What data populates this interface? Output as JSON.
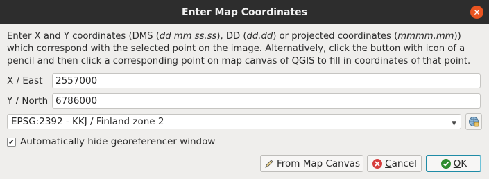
{
  "window": {
    "title": "Enter Map Coordinates",
    "close_icon": "close-icon"
  },
  "description": {
    "p1": "Enter X and Y coordinates (DMS (",
    "p1_em": "dd mm ss.ss",
    "p2": "), DD (",
    "p2_em": "dd.dd",
    "p3": ") or projected coordinates (",
    "p3_em": "mmmm.mm",
    "p4": "))",
    "line2": "which correspond with the selected point on the image. Alternatively, click the button with icon of a",
    "line3": "pencil and then click a corresponding point on map canvas of QGIS to fill in coordinates of that point."
  },
  "x_field": {
    "label": "X / East",
    "value": "2557000"
  },
  "y_field": {
    "label": "Y / North",
    "value": "6786000"
  },
  "crs": {
    "selected": "EPSG:2392 - KKJ / Finland zone 2",
    "button_icon": "crs-selector-icon"
  },
  "auto_hide": {
    "label": "Automatically hide georeferencer window",
    "checked": true
  },
  "buttons": {
    "from_map": "From Map Canvas",
    "cancel_first": "C",
    "cancel_rest": "ancel",
    "ok_first": "O",
    "ok_rest": "K"
  },
  "colors": {
    "accent": "#e95420",
    "titlebar": "#2d2d2d",
    "ok_border": "#1f8ba6"
  }
}
